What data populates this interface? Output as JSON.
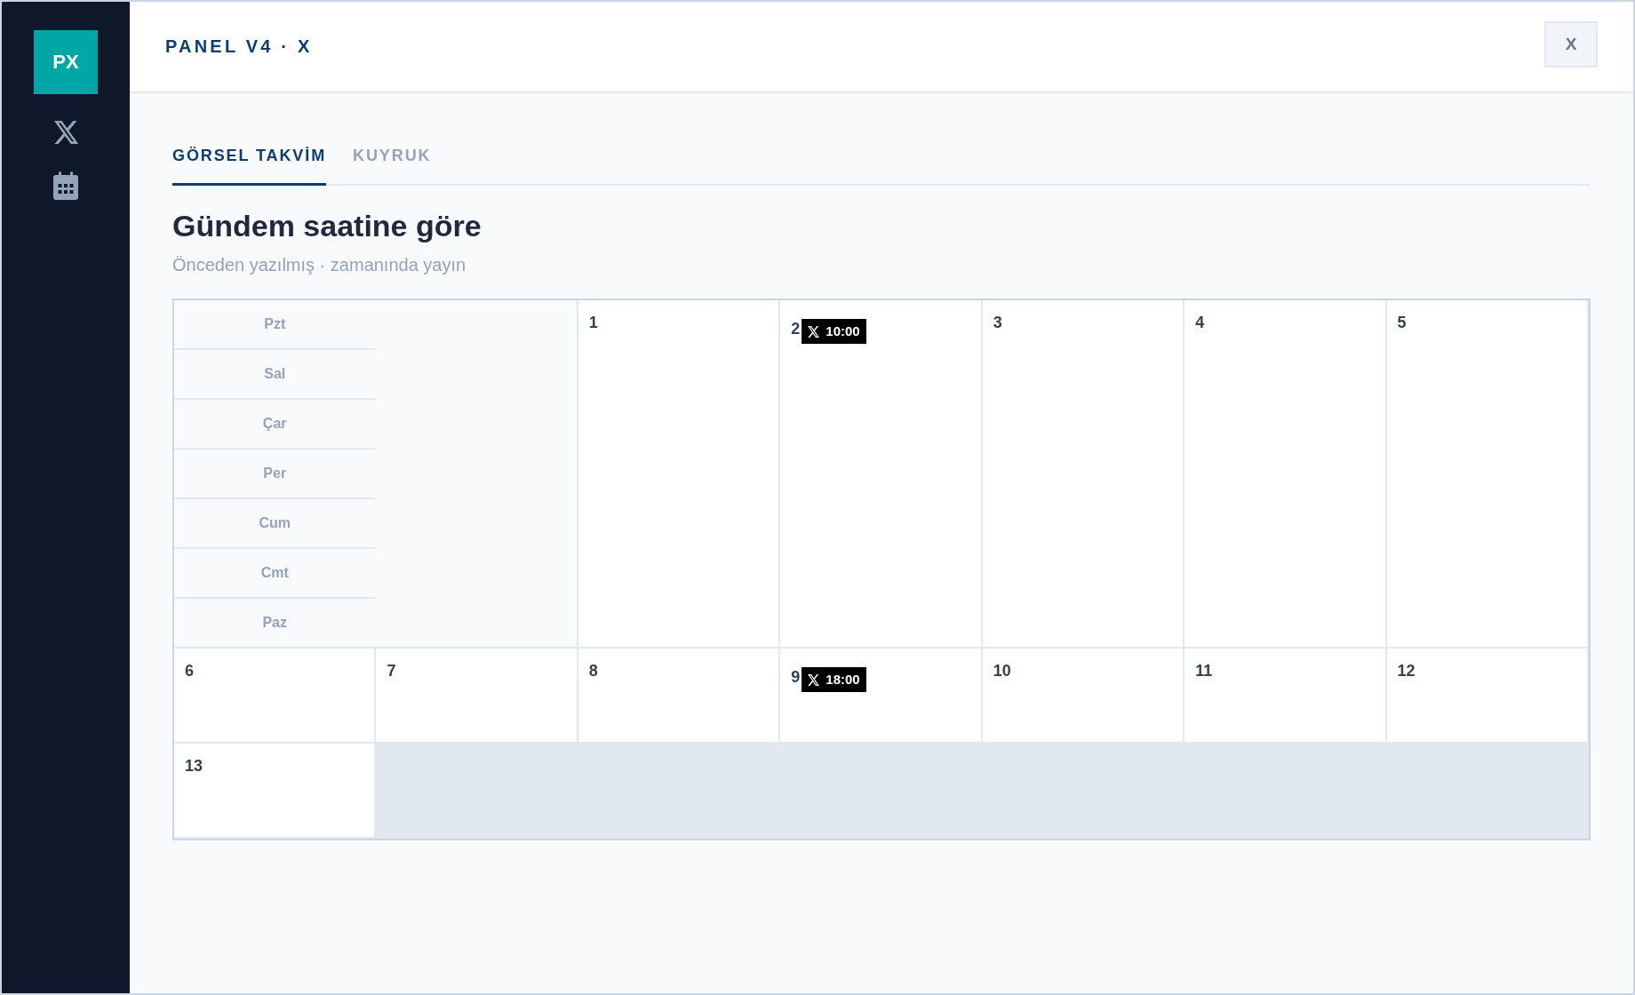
{
  "sidebar": {
    "logo": "PX"
  },
  "header": {
    "title": "PANEL V4 · X",
    "close_label": "X"
  },
  "tabs": [
    {
      "label": "GÖRSEL TAKVİM",
      "selected": true
    },
    {
      "label": "KUYRUK",
      "selected": false
    }
  ],
  "heading": "Gündem saatine göre",
  "subtitle": "Önceden yazılmış · zamanında yayın",
  "calendar": {
    "weekdays": [
      "Pzt",
      "Sal",
      "Çar",
      "Per",
      "Cum",
      "Cmt",
      "Paz"
    ],
    "days": [
      {
        "number": "1"
      },
      {
        "number": "2",
        "events": [
          {
            "time": "10:00"
          }
        ]
      },
      {
        "number": "3"
      },
      {
        "number": "4"
      },
      {
        "number": "5"
      },
      {
        "number": "6"
      },
      {
        "number": "7"
      },
      {
        "number": "8"
      },
      {
        "number": "9",
        "events": [
          {
            "time": "18:00"
          }
        ]
      },
      {
        "number": "10"
      },
      {
        "number": "11"
      },
      {
        "number": "12"
      },
      {
        "number": "13"
      }
    ]
  }
}
